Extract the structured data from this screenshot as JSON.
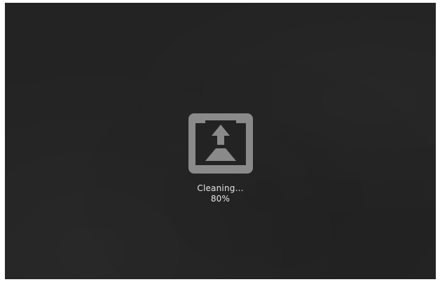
{
  "status": {
    "label": "Cleaning...",
    "progress_text": "80%",
    "progress": 0.8
  },
  "icon": {
    "name": "cleaning-icon",
    "color": "#8a8a8a",
    "background": "#232323"
  }
}
